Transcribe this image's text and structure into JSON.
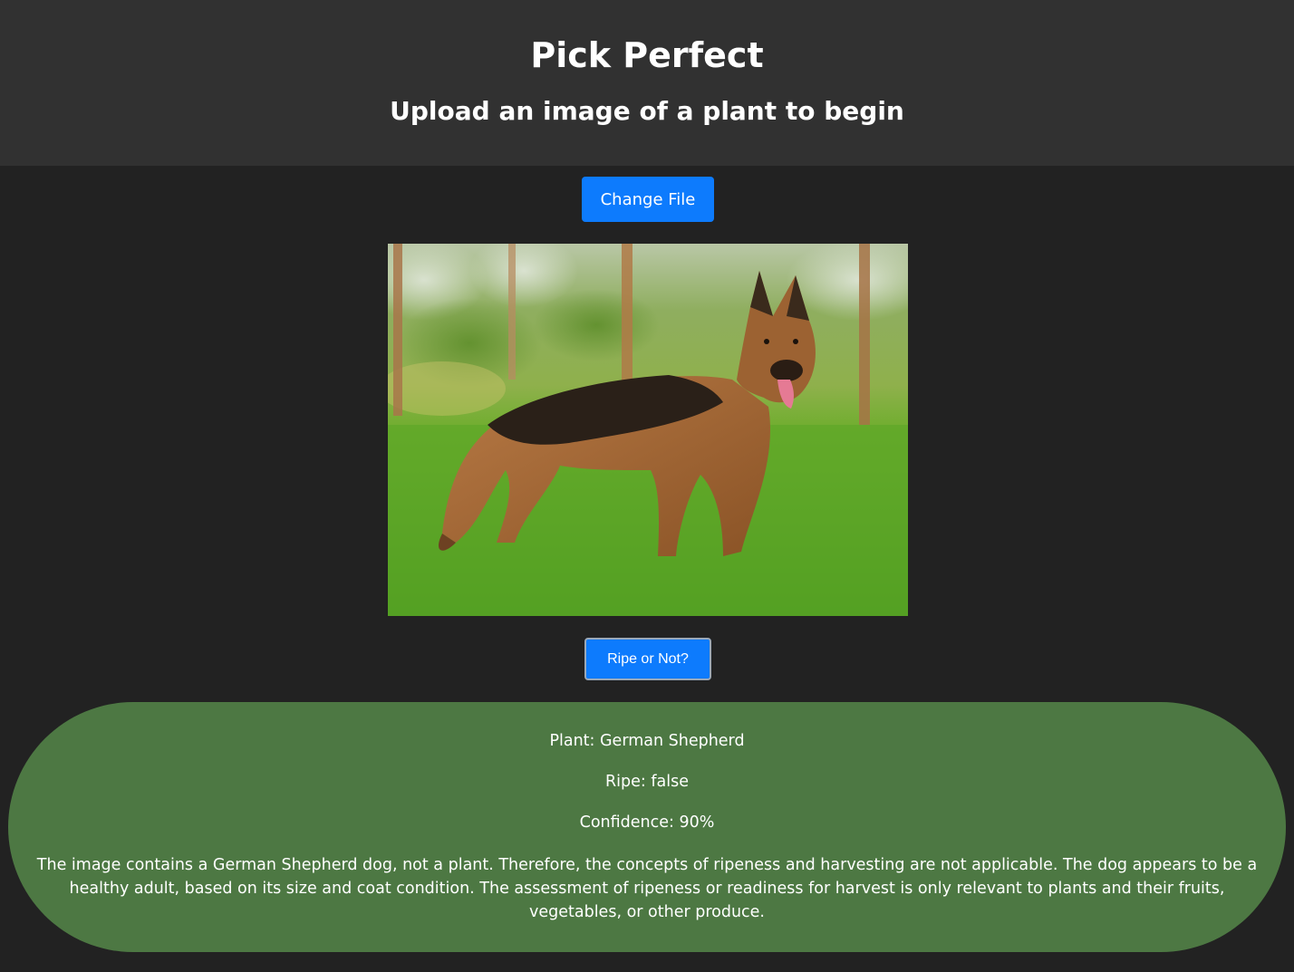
{
  "header": {
    "title": "Pick Perfect",
    "subtitle": "Upload an image of a plant to begin"
  },
  "upload": {
    "change_file_label": "Change File"
  },
  "preview": {
    "image_subject": "german-shepherd-dog-on-grass"
  },
  "action": {
    "ripe_button_label": "Ripe or Not?"
  },
  "result": {
    "plant": "Plant: German Shepherd",
    "ripe": "Ripe: false",
    "confidence": "Confidence: 90%",
    "description": "The image contains a German Shepherd dog, not a plant. Therefore, the concepts of ripeness and harvesting are not applicable. The dog appears to be a healthy adult, based on its size and coat condition. The assessment of ripeness or readiness for harvest is only relevant to plants and their fruits, vegetables, or other produce."
  },
  "colors": {
    "header_bg": "#313131",
    "page_bg": "#222222",
    "button_blue": "#0d7bfd",
    "result_green": "#4d7843"
  }
}
